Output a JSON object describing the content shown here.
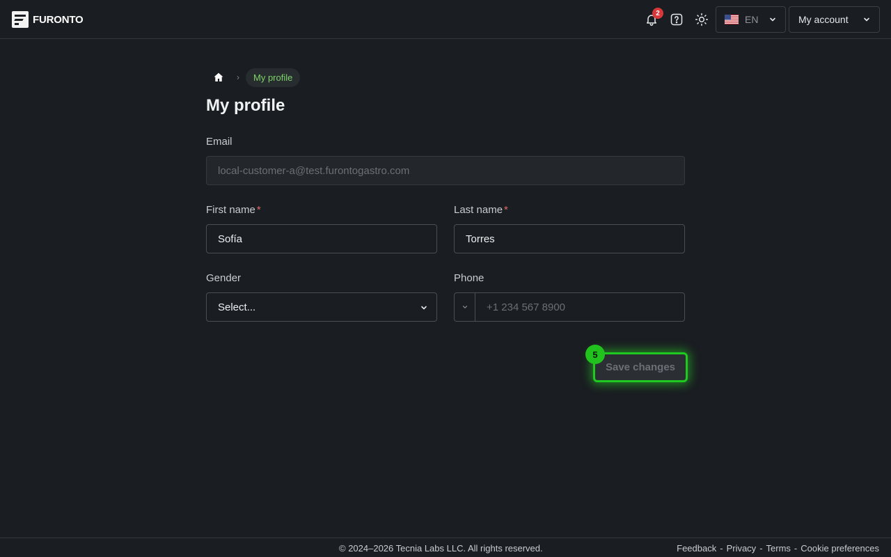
{
  "header": {
    "brand": "FURONTO",
    "notifications_count": "2",
    "language": "EN",
    "account_label": "My account",
    "icons": [
      "bell-icon",
      "help-icon",
      "sun-icon",
      "us-flag-icon",
      "chevron-down-icon"
    ]
  },
  "breadcrumb": {
    "current": "My profile"
  },
  "page": {
    "title": "My profile"
  },
  "form": {
    "email_label": "Email",
    "email_value": "local-customer-a@test.furontogastro.com",
    "first_name_label": "First name",
    "first_name_value": "Sofía",
    "last_name_label": "Last name",
    "last_name_value": "Torres",
    "required_mark": "*",
    "gender_label": "Gender",
    "gender_value": "Select...",
    "phone_label": "Phone",
    "phone_placeholder": "+1 234 567 8900",
    "save_label": "Save changes",
    "step_number": "5"
  },
  "footer": {
    "copyright": "© 2024–2026 Tecnia Labs LLC. All rights reserved.",
    "links": [
      "Feedback",
      "Privacy",
      "Terms",
      "Cookie preferences"
    ],
    "separator": "-"
  },
  "colors": {
    "background": "#1a1d21",
    "accent_green": "#1fc91f",
    "breadcrumb_green": "#7fd46b",
    "badge_red": "#d9383a",
    "required_red": "#e06a6a"
  }
}
